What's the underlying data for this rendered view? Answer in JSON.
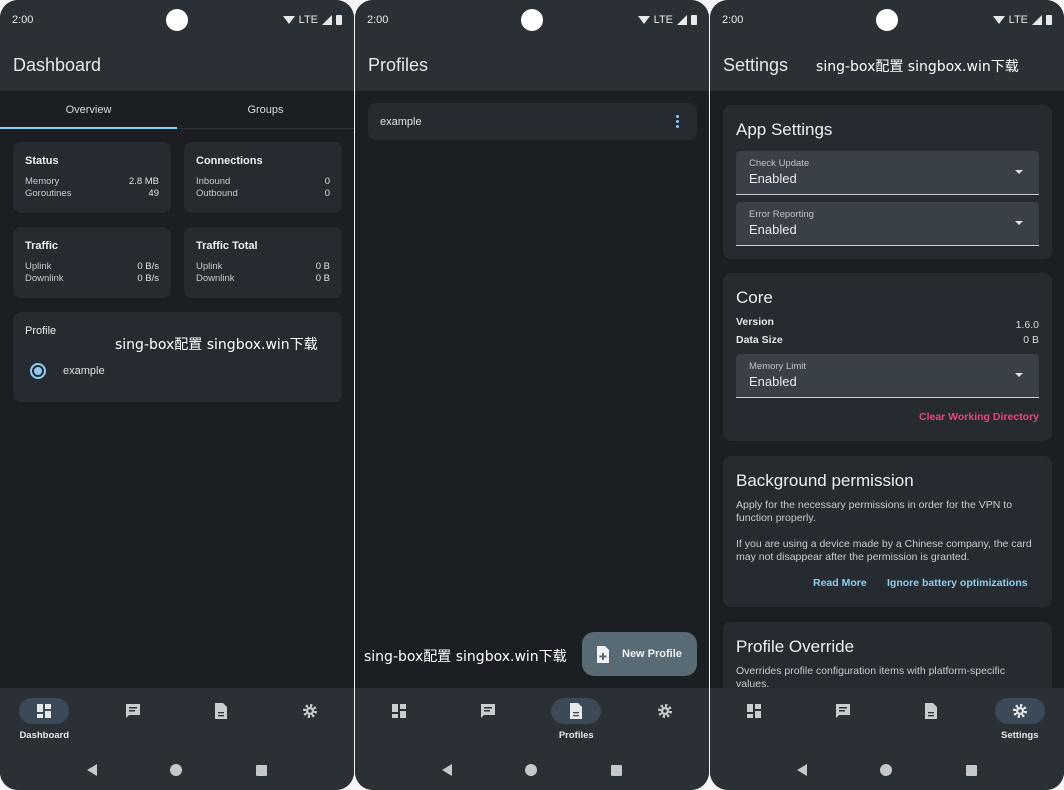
{
  "status": {
    "time": "2:00",
    "network": "LTE"
  },
  "watermark": "sing-box配置 singbox.win下载",
  "nav": {
    "dashboard": "Dashboard",
    "profiles": "Profiles",
    "settings": "Settings"
  },
  "colors": {
    "accent": "#8fcdf0",
    "danger": "#e8457a",
    "background": "#1b1e22",
    "surface": "#262b31"
  },
  "dashboard": {
    "title": "Dashboard",
    "tabs": [
      "Overview",
      "Groups"
    ],
    "status_card": {
      "title": "Status",
      "rows": [
        {
          "label": "Memory",
          "value": "2.8 MB"
        },
        {
          "label": "Goroutines",
          "value": "49"
        }
      ]
    },
    "connections_card": {
      "title": "Connections",
      "rows": [
        {
          "label": "Inbound",
          "value": "0"
        },
        {
          "label": "Outbound",
          "value": "0"
        }
      ]
    },
    "traffic_card": {
      "title": "Traffic",
      "rows": [
        {
          "label": "Uplink",
          "value": "0 B/s"
        },
        {
          "label": "Downlink",
          "value": "0 B/s"
        }
      ]
    },
    "traffic_total_card": {
      "title": "Traffic Total",
      "rows": [
        {
          "label": "Uplink",
          "value": "0 B"
        },
        {
          "label": "Downlink",
          "value": "0 B"
        }
      ]
    },
    "profile_card": {
      "title": "Profile",
      "selected": "example"
    }
  },
  "profiles": {
    "title": "Profiles",
    "items": [
      "example"
    ],
    "new_profile_label": "New Profile"
  },
  "settings": {
    "title": "Settings",
    "app_settings": {
      "title": "App Settings",
      "check_update": {
        "label": "Check Update",
        "value": "Enabled"
      },
      "error_reporting": {
        "label": "Error Reporting",
        "value": "Enabled"
      }
    },
    "core": {
      "title": "Core",
      "version_label": "Version",
      "version_value": "1.6.0",
      "data_size_label": "Data Size",
      "data_size_value": "0 B",
      "memory_limit": {
        "label": "Memory Limit",
        "value": "Enabled"
      },
      "clear_label": "Clear Working Directory"
    },
    "background_permission": {
      "title": "Background permission",
      "text1": "Apply for the necessary permissions in order for the VPN to function properly.",
      "text2": "If you are using a device made by a Chinese company, the card may not disappear after the permission is granted.",
      "read_more": "Read More",
      "ignore_battery": "Ignore battery optimizations"
    },
    "profile_override": {
      "title": "Profile Override",
      "text": "Overrides profile configuration items with platform-specific values."
    }
  }
}
